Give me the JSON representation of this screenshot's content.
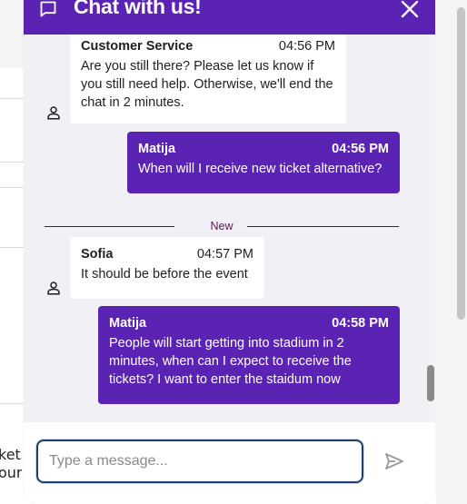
{
  "background": {
    "fragment_lines": [
      "kets",
      "our"
    ]
  },
  "header": {
    "title": "Chat with us!",
    "chat_icon": "chat-bubble-icon",
    "close_icon": "close-icon"
  },
  "conversation": {
    "messages": [
      {
        "role": "agent",
        "sender": "Customer Service",
        "time": "04:56 PM",
        "text": "Are you still there? Please let us know if you still need help. Otherwise, we'll end the chat in 2 minutes."
      },
      {
        "role": "user",
        "sender": "Matija",
        "time": "04:56 PM",
        "text": "When will I receive new ticket alternative?"
      },
      {
        "role": "agent",
        "sender": "Sofia",
        "time": "04:57 PM",
        "text": "It should be before the event"
      },
      {
        "role": "user",
        "sender": "Matija",
        "time": "04:58 PM",
        "text": "People will start getting into stadium in 2 minutes, when can I expect to receive the tickets? I want to enter the staidum now"
      }
    ],
    "divider_label": "New"
  },
  "composer": {
    "placeholder": "Type a message...",
    "value": "",
    "send_icon": "send-icon"
  },
  "colors": {
    "brand": "#5b23b3",
    "chat_background": "#f1f0f4",
    "divider_label": "#5b1a52"
  }
}
